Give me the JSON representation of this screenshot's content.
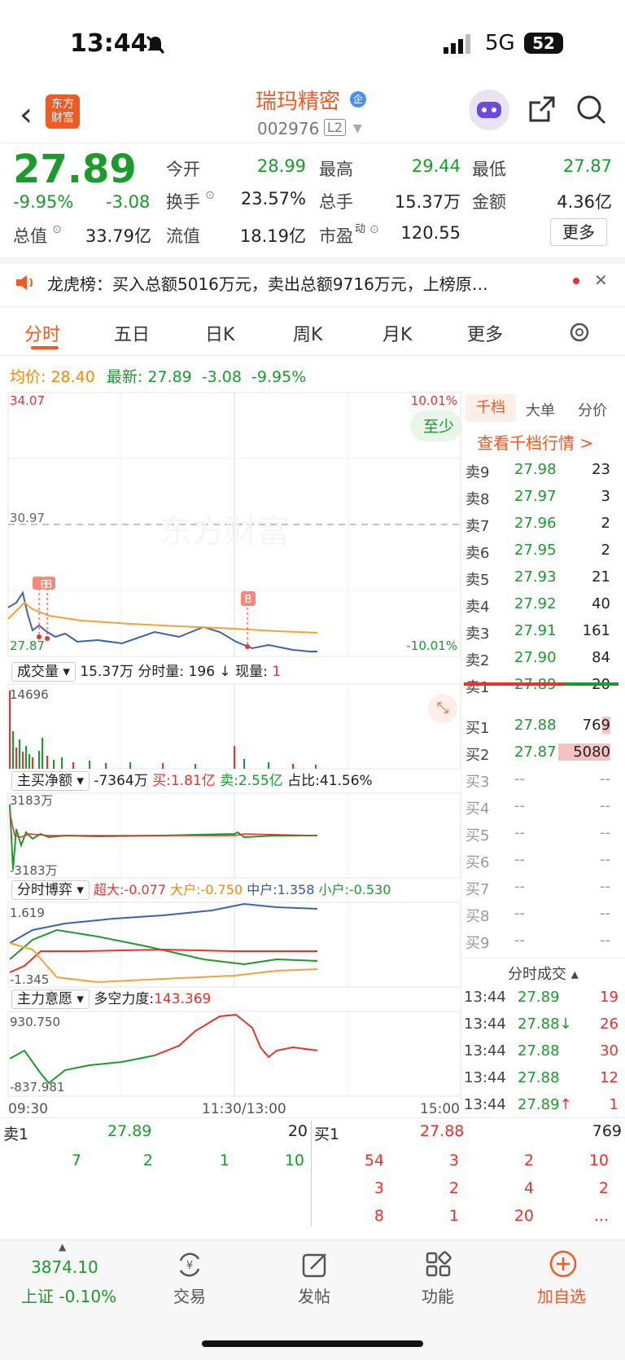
{
  "status_bar": {
    "time": "13:44",
    "network": "5G",
    "battery": "52"
  },
  "header": {
    "logo_line1": "东方",
    "logo_line2": "财富",
    "stock_name": "瑞玛精密",
    "badge": "企",
    "stock_code": "002976",
    "level": "L2"
  },
  "quote": {
    "price": "27.89",
    "change_pct": "-9.95%",
    "change": "-3.08",
    "fields": [
      {
        "label": "今开",
        "value": "28.99",
        "color": "#1a9b2c"
      },
      {
        "label": "最高",
        "value": "29.44",
        "color": "#1a9b2c"
      },
      {
        "label": "最低",
        "value": "27.87",
        "color": "#1a9b2c"
      },
      {
        "label": "换手",
        "value": "23.57%",
        "color": "#222222"
      },
      {
        "label": "总手",
        "value": "15.37万",
        "color": "#222222"
      },
      {
        "label": "金额",
        "value": "4.36亿",
        "color": "#222222"
      },
      {
        "label": "总值",
        "value": "33.79亿",
        "color": "#222222"
      },
      {
        "label": "流值",
        "value": "18.19亿",
        "color": "#222222"
      },
      {
        "label": "市盈",
        "value": "120.55",
        "color": "#222222"
      }
    ],
    "pe_sup": "动",
    "more_label": "更多"
  },
  "notice": {
    "text": "龙虎榜：买入总额5016万元，卖出总额9716万元，上榜原…"
  },
  "tabs": [
    "分时",
    "五日",
    "日K",
    "周K",
    "月K",
    "更多"
  ],
  "avg_row": {
    "avg_label": "均价:",
    "avg_value": "28.40",
    "last_label": "最新:",
    "last_value": "27.89",
    "last_change": "-3.08",
    "last_pct": "-9.95%"
  },
  "main_chart": {
    "y_top": "34.07",
    "y_mid": "30.97",
    "y_bottom": "27.87",
    "pct_top": "10.01%",
    "pct_bottom": "-10.01%",
    "watermark": "东方财富",
    "pill": "至少",
    "markers": [
      "B",
      "B",
      "B"
    ]
  },
  "volume": {
    "label": "成交量",
    "total": "15.37万",
    "minute_label": "分时量:",
    "minute_val": "196",
    "now_label": "现量:",
    "now_val": "1",
    "ytop": "14696"
  },
  "netbuy": {
    "label": "主买净额",
    "value": "-7364万",
    "buy_label": "买:1.81亿",
    "sell_label": "卖:2.55亿",
    "ratio": "占比:41.56%",
    "ytop": "3183万",
    "ybottom": "-3183万"
  },
  "game": {
    "label": "分时博弈",
    "super": "超大:-0.077",
    "big": "大户:-0.750",
    "mid": "中户:1.358",
    "small": "小户:-0.530",
    "ytop": "1.619",
    "ybottom": "-1.345"
  },
  "intent": {
    "label": "主力意愿",
    "power": "多空力度:",
    "power_val": "143.369",
    "ytop": "930.750",
    "ybottom": "-837.981"
  },
  "time_axis": [
    "09:30",
    "11:30/13:00",
    "15:00"
  ],
  "orderbook": {
    "tabs": [
      "千档",
      "大单",
      "分价"
    ],
    "link": "查看千档行情 >",
    "asks": [
      {
        "label": "卖9",
        "price": "27.98",
        "vol": "23"
      },
      {
        "label": "卖8",
        "price": "27.97",
        "vol": "3"
      },
      {
        "label": "卖7",
        "price": "27.96",
        "vol": "2"
      },
      {
        "label": "卖6",
        "price": "27.95",
        "vol": "2"
      },
      {
        "label": "卖5",
        "price": "27.93",
        "vol": "21"
      },
      {
        "label": "卖4",
        "price": "27.92",
        "vol": "40"
      },
      {
        "label": "卖3",
        "price": "27.91",
        "vol": "161"
      },
      {
        "label": "卖2",
        "price": "27.90",
        "vol": "84"
      },
      {
        "label": "卖1",
        "price": "27.89",
        "vol": "20"
      }
    ],
    "bids": [
      {
        "label": "买1",
        "price": "27.88",
        "vol": "769"
      },
      {
        "label": "买2",
        "price": "27.87",
        "vol": "5080"
      },
      {
        "label": "买3",
        "price": "--",
        "vol": "--"
      },
      {
        "label": "买4",
        "price": "--",
        "vol": "--"
      },
      {
        "label": "买5",
        "price": "--",
        "vol": "--"
      },
      {
        "label": "买6",
        "price": "--",
        "vol": "--"
      },
      {
        "label": "买7",
        "price": "--",
        "vol": "--"
      },
      {
        "label": "买8",
        "price": "--",
        "vol": "--"
      },
      {
        "label": "买9",
        "price": "--",
        "vol": "--"
      }
    ],
    "trades_title": "分时成交",
    "trades": [
      {
        "time": "13:44",
        "price": "27.89",
        "arrow": "",
        "vol": "19"
      },
      {
        "time": "13:44",
        "price": "27.88",
        "arrow": "↓",
        "vol": "26"
      },
      {
        "time": "13:44",
        "price": "27.88",
        "arrow": "",
        "vol": "30"
      },
      {
        "time": "13:44",
        "price": "27.88",
        "arrow": "",
        "vol": "12"
      },
      {
        "time": "13:44",
        "price": "27.89",
        "arrow": "↑",
        "vol": "1"
      }
    ]
  },
  "queue": {
    "sell_label": "卖1",
    "sell_price": "27.89",
    "sell_vol": "20",
    "buy_label": "买1",
    "buy_price": "27.88",
    "buy_vol": "769",
    "sell_orders": [
      "7",
      "2",
      "1",
      "10"
    ],
    "buy_orders": [
      [
        "54",
        "3",
        "2",
        "10"
      ],
      [
        "3",
        "2",
        "4",
        "2"
      ],
      [
        "8",
        "1",
        "20",
        "..."
      ]
    ]
  },
  "bottom_nav": {
    "index_value": "3874.10",
    "index_name": "上证",
    "index_pct": "-0.10%",
    "items": [
      "交易",
      "发帖",
      "功能",
      "加自选"
    ]
  }
}
